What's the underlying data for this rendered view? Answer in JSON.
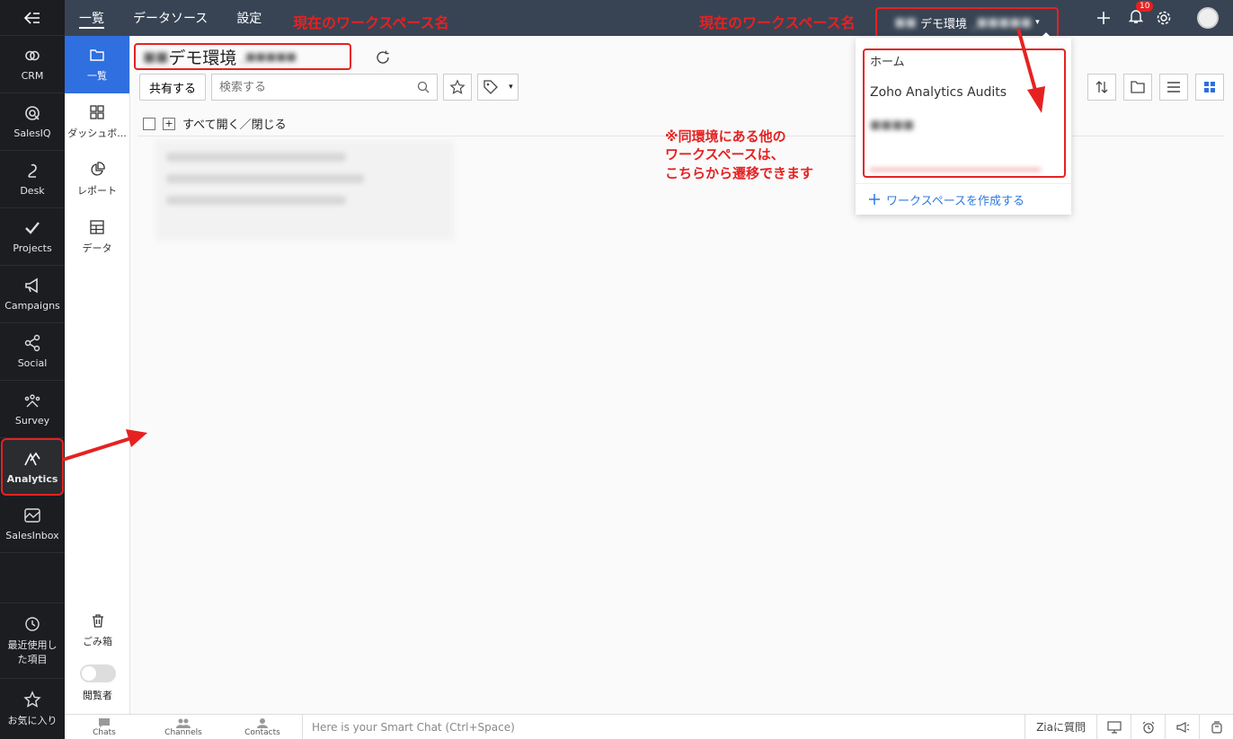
{
  "rail": {
    "apps": [
      {
        "label": "CRM",
        "icon": "crm-icon"
      },
      {
        "label": "SalesIQ",
        "icon": "salesiq-icon"
      },
      {
        "label": "Desk",
        "icon": "desk-icon"
      },
      {
        "label": "Projects",
        "icon": "projects-icon"
      },
      {
        "label": "Campaigns",
        "icon": "campaigns-icon"
      },
      {
        "label": "Social",
        "icon": "social-icon"
      },
      {
        "label": "Survey",
        "icon": "survey-icon"
      },
      {
        "label": "Analytics",
        "icon": "analytics-icon"
      },
      {
        "label": "SalesInbox",
        "icon": "salesinbox-icon"
      }
    ],
    "recent": "最近使用した項目",
    "favorites": "お気に入り"
  },
  "topbar": {
    "tabs": [
      "一覧",
      "データソース",
      "設定"
    ],
    "annotation_left": "現在のワークスペース名",
    "annotation_right": "現在のワークスペース名",
    "workspace_name": "デモ環境",
    "notification_count": "10"
  },
  "subside": {
    "items": [
      "一覧",
      "ダッシュボ...",
      "レポート",
      "データ"
    ],
    "trash": "ごみ箱",
    "viewer": "閲覧者"
  },
  "main": {
    "workspace_title": "デモ環境",
    "share_button": "共有する",
    "search_placeholder": "検索する",
    "expand_label": "すべて開く／閉じる"
  },
  "dropdown": {
    "home": "ホーム",
    "audits": "Zoho Analytics Audits",
    "create": "ワークスペースを作成する"
  },
  "annotation_note": [
    "※同環境にある他の",
    "ワークスペースは、",
    "こちらから遷移できます"
  ],
  "chatbar": {
    "chats": "Chats",
    "channels": "Channels",
    "contacts": "Contacts",
    "smart_chat": "Here is your Smart Chat (Ctrl+Space)",
    "zia": "Ziaに質問"
  },
  "colors": {
    "accent": "#e52222",
    "primary": "#2f6fe0",
    "topbar": "#384454",
    "rail": "#1b1d21"
  }
}
